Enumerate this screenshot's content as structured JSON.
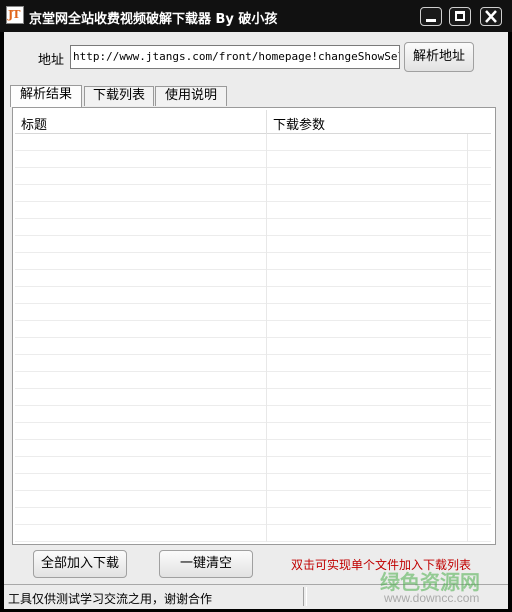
{
  "window": {
    "title": "京堂网全站收费视频破解下载器 By 破小孩",
    "icon_text": "JT"
  },
  "address": {
    "label": "地址",
    "value": "http://www.jtangs.com/front/homepage!changeShowSellWay",
    "parse_button": "解析地址"
  },
  "tabs": [
    {
      "label": "解析结果",
      "active": true
    },
    {
      "label": "下载列表",
      "active": false
    },
    {
      "label": "使用说明",
      "active": false
    }
  ],
  "results_table": {
    "columns": [
      "标题",
      "下载参数"
    ],
    "rows": []
  },
  "actions": {
    "add_all": "全部加入下载",
    "clear_all": "一键清空",
    "hint": "双击可实现单个文件加入下载列表"
  },
  "status_bar": {
    "text": "工具仅供测试学习交流之用，谢谢合作"
  },
  "watermark": {
    "cn": "绿色资源网",
    "url": "www.downcc.com"
  },
  "colors": {
    "titlebar": "#111111",
    "hint_text": "#c00000",
    "watermark": "#4bb04b"
  }
}
